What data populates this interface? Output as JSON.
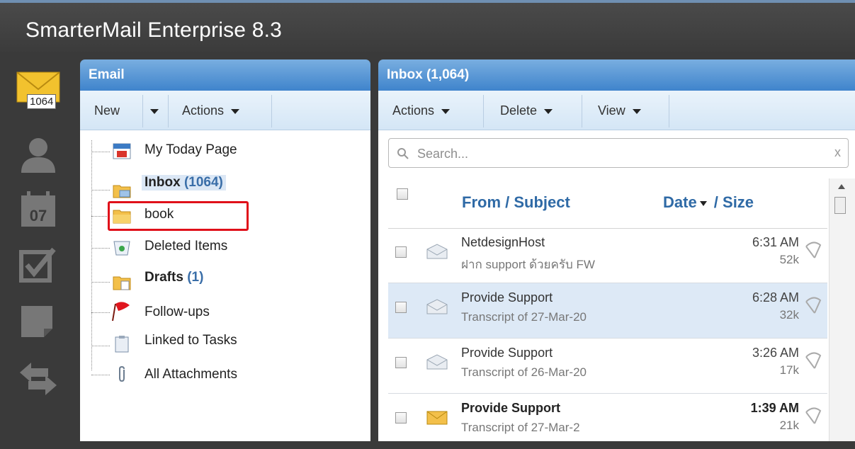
{
  "app": {
    "title": "SmarterMail Enterprise 8.3"
  },
  "iconbar": {
    "mail_count": "1064",
    "icons": [
      "mail-icon",
      "contacts-icon",
      "calendar-icon",
      "tasks-icon",
      "notes-icon",
      "sync-icon"
    ]
  },
  "email_panel": {
    "title": "Email",
    "toolbar": {
      "new_label": "New",
      "actions_label": "Actions"
    },
    "folders": [
      {
        "label": "My Today Page",
        "count": "",
        "bold": false,
        "icon": "today-page-icon"
      },
      {
        "label": "Inbox",
        "count": "(1064)",
        "bold": true,
        "icon": "inbox-folder-icon"
      },
      {
        "label": "book",
        "count": "",
        "bold": false,
        "icon": "folder-icon"
      },
      {
        "label": "Deleted Items",
        "count": "",
        "bold": false,
        "icon": "deleted-items-icon"
      },
      {
        "label": "Drafts",
        "count": "(1)",
        "bold": true,
        "icon": "drafts-icon"
      },
      {
        "label": "Follow-ups",
        "count": "",
        "bold": false,
        "icon": "flag-icon"
      },
      {
        "label": "Linked to Tasks",
        "count": "",
        "bold": false,
        "icon": "clipboard-icon"
      },
      {
        "label": "All Attachments",
        "count": "",
        "bold": false,
        "icon": "paperclip-icon"
      }
    ]
  },
  "inbox_panel": {
    "title": "Inbox (1,064)",
    "toolbar": {
      "actions_label": "Actions",
      "delete_label": "Delete",
      "view_label": "View"
    },
    "search": {
      "placeholder": "Search..."
    },
    "columns": {
      "from_subject": "From / Subject",
      "date": "Date",
      "size": " / Size"
    },
    "messages": [
      {
        "from": "NetdesignHost",
        "subject": "ฝาก support ด้วยครับ FW",
        "time": "6:31 AM",
        "size": "52k",
        "unread": false,
        "selected": false
      },
      {
        "from": "Provide Support",
        "subject": "Transcript of 27-Mar-20",
        "time": "6:28 AM",
        "size": "32k",
        "unread": false,
        "selected": true
      },
      {
        "from": "Provide Support",
        "subject": "Transcript of 26-Mar-20",
        "time": "3:26 AM",
        "size": "17k",
        "unread": false,
        "selected": false
      },
      {
        "from": "Provide Support",
        "subject": "Transcript of 27-Mar-2",
        "time": "1:39 AM",
        "size": "21k",
        "unread": true,
        "selected": false
      }
    ]
  },
  "colors": {
    "panel_header": "#3f84cc",
    "highlight_box": "#e0101a",
    "selected_row": "#dde9f6",
    "dark_bg": "#3a3a3a"
  }
}
